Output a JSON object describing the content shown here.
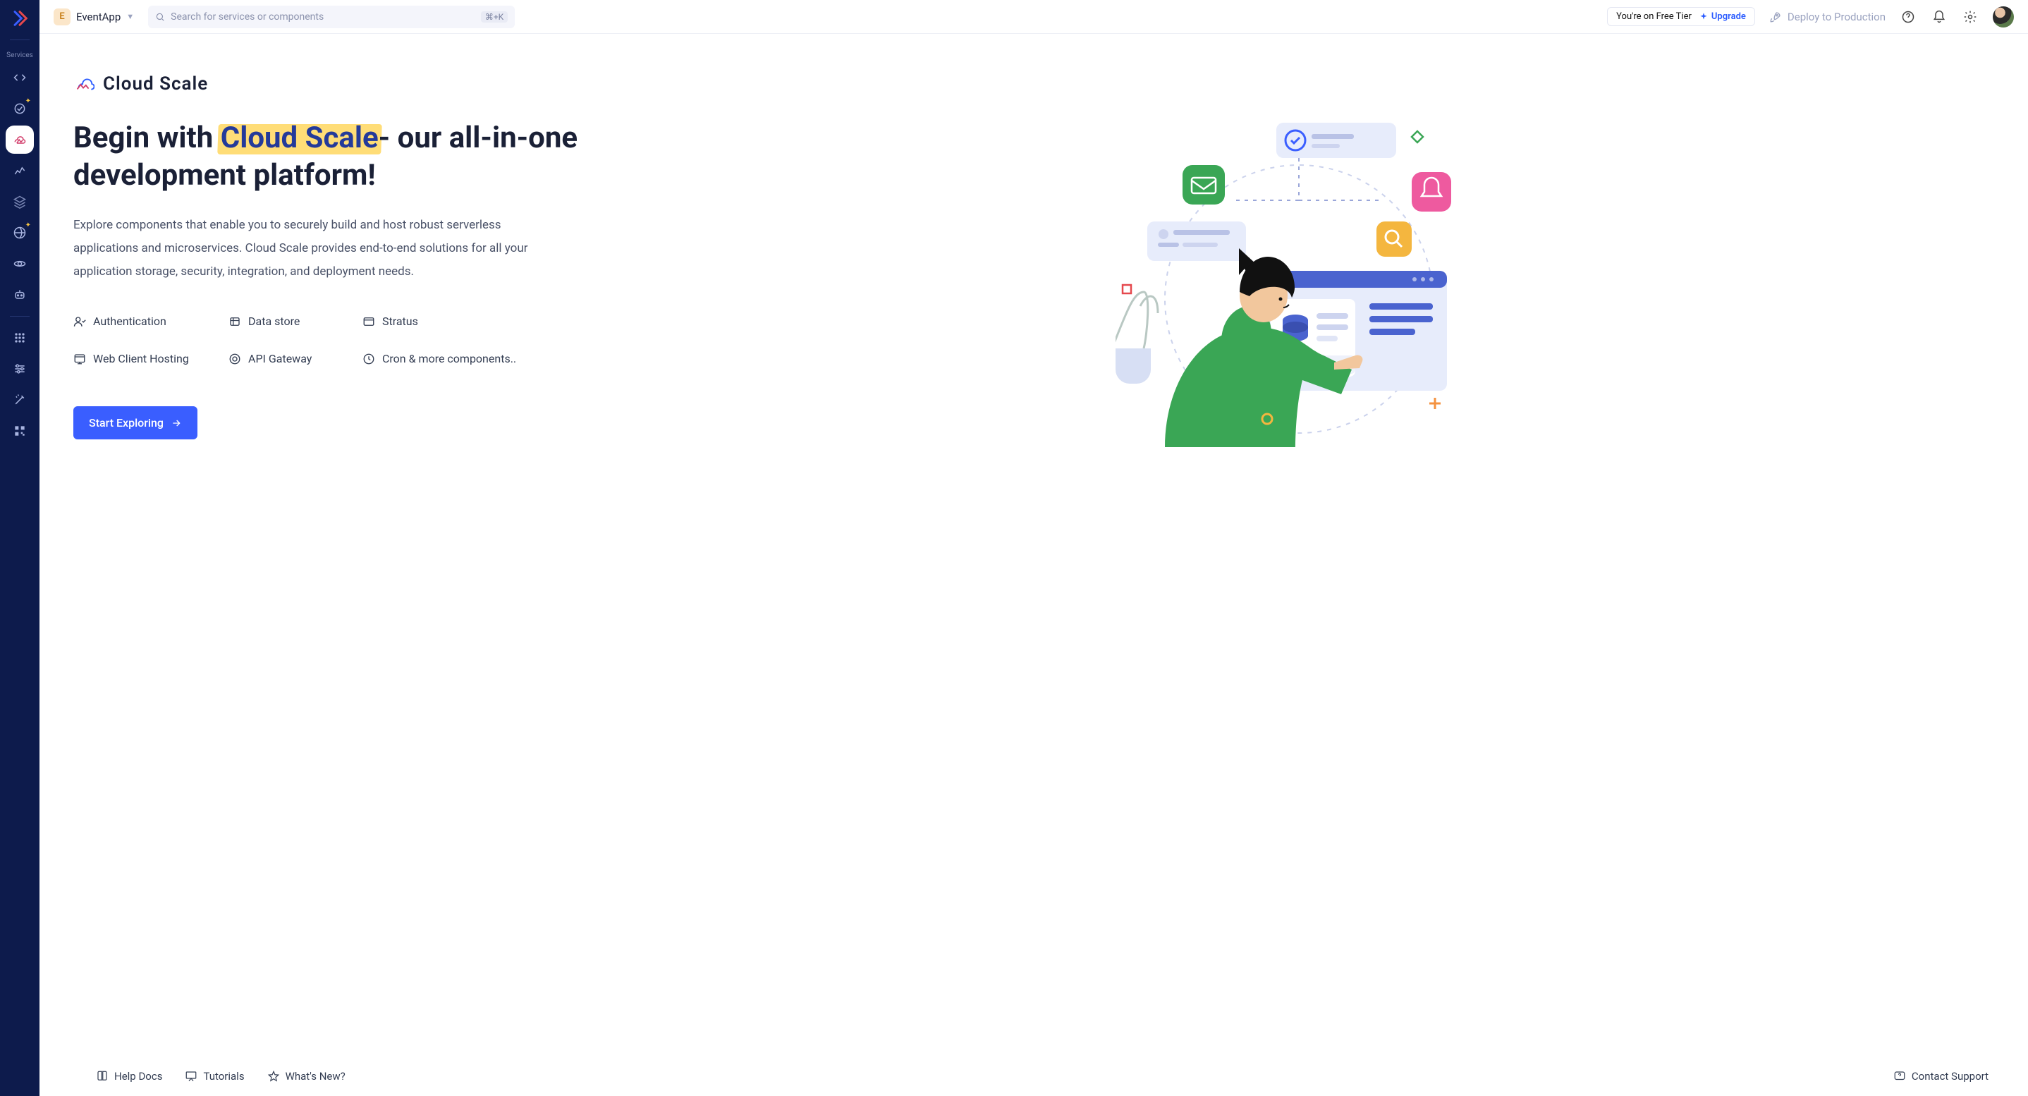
{
  "sidebar": {
    "section_label": "Services"
  },
  "topbar": {
    "project_initial": "E",
    "project_name": "EventApp",
    "search_placeholder": "Search for services or components",
    "search_shortcut": "⌘+K",
    "tier_text": "You're on Free Tier",
    "upgrade_label": "Upgrade",
    "deploy_label": "Deploy to Production"
  },
  "hero": {
    "brand_name": "Cloud Scale",
    "headline_pre": "Begin with ",
    "headline_hl": "Cloud Scale",
    "headline_post": "- our all-in-one development platform!",
    "lede": "Explore components that enable you to securely build and host robust serverless applications and microservices. Cloud Scale provides end-to-end solutions for all your application storage, security, integration, and deployment needs.",
    "cta": "Start Exploring"
  },
  "features": [
    "Authentication",
    "Data store",
    "Stratus",
    "Web Client Hosting",
    "API Gateway",
    "Cron & more components.."
  ],
  "footer": {
    "help": "Help Docs",
    "tutorials": "Tutorials",
    "whatsnew": "What's New?",
    "support": "Contact Support"
  }
}
